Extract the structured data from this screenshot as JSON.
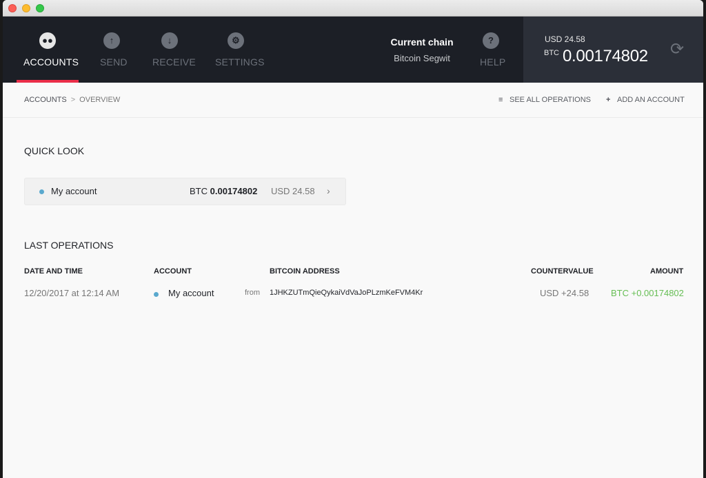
{
  "nav": {
    "items": [
      {
        "label": "ACCOUNTS",
        "icon": "accounts-icon",
        "active": true
      },
      {
        "label": "SEND",
        "icon": "send-icon",
        "active": false
      },
      {
        "label": "RECEIVE",
        "icon": "receive-icon",
        "active": false
      },
      {
        "label": "SETTINGS",
        "icon": "gear-icon",
        "active": false
      }
    ],
    "help_label": "HELP",
    "active_color": "#ea2e49"
  },
  "chain": {
    "title": "Current chain",
    "value": "Bitcoin Segwit"
  },
  "balance": {
    "usd": "USD 24.58",
    "btc_label": "BTC",
    "btc_value": "0.00174802"
  },
  "breadcrumb": {
    "root": "ACCOUNTS",
    "separator": ">",
    "current": "OVERVIEW"
  },
  "actions": {
    "see_all": "SEE ALL OPERATIONS",
    "add_account": "ADD AN ACCOUNT"
  },
  "quick_look": {
    "title": "QUICK LOOK",
    "account": {
      "name": "My account",
      "btc_label": "BTC",
      "btc_value": "0.00174802",
      "usd": "USD 24.58",
      "dot_color": "#5aa9ce"
    }
  },
  "last_operations": {
    "title": "LAST OPERATIONS",
    "columns": {
      "date": "DATE AND TIME",
      "account": "ACCOUNT",
      "address": "BITCOIN ADDRESS",
      "countervalue": "COUNTERVALUE",
      "amount": "AMOUNT"
    },
    "rows": [
      {
        "date": "12/20/2017 at 12:14 AM",
        "account": "My account",
        "direction": "from",
        "address": "1JHKZUTmQieQykaiVdVaJoPLzmKeFVM4Kr",
        "countervalue": "USD +24.58",
        "amount": "BTC +0.00174802",
        "amount_color": "#66be54"
      }
    ]
  }
}
